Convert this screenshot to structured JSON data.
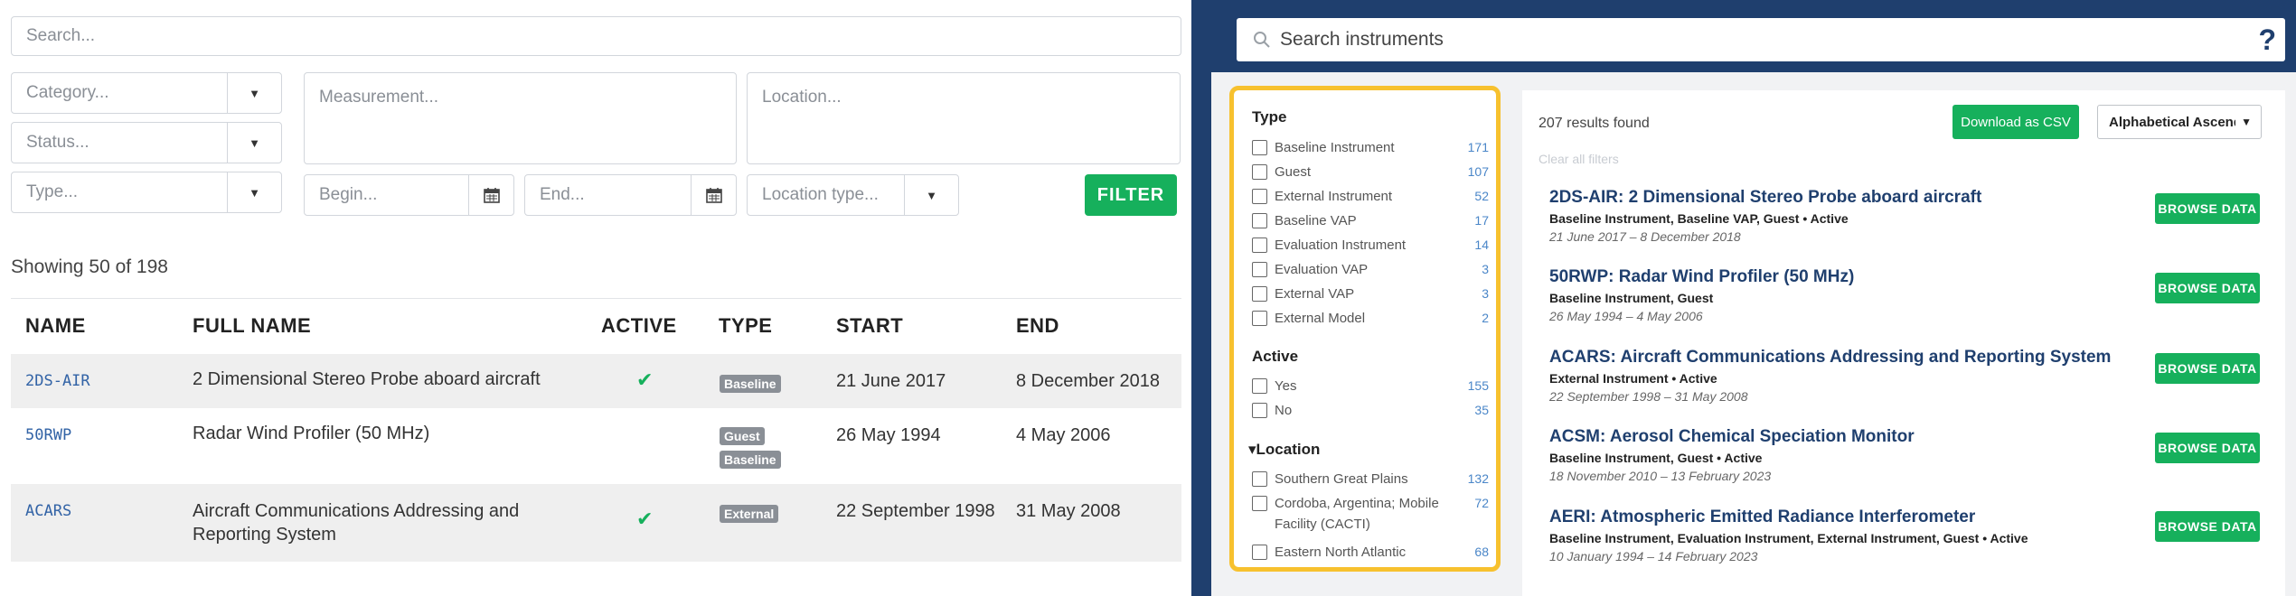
{
  "left": {
    "search_placeholder": "Search...",
    "category_placeholder": "Category...",
    "status_placeholder": "Status...",
    "type_placeholder": "Type...",
    "measurement_placeholder": "Measurement...",
    "location_placeholder": "Location...",
    "begin_placeholder": "Begin...",
    "end_placeholder": "End...",
    "location_type_placeholder": "Location type...",
    "filter_label": "FILTER",
    "showing": "Showing 50 of 198",
    "columns": [
      "NAME",
      "FULL NAME",
      "ACTIVE",
      "TYPE",
      "START",
      "END"
    ],
    "rows": [
      {
        "name": "2DS-AIR",
        "full_name_1": "2 Dimensional Stereo Probe aboard aircraft",
        "full_name_2": "",
        "active": "✔",
        "badge_1": "Baseline",
        "badge_2": "",
        "start": "21 June 2017",
        "end": "8 December 2018"
      },
      {
        "name": "50RWP",
        "full_name_1": "Radar Wind Profiler (50 MHz)",
        "full_name_2": "",
        "active": "",
        "badge_1": "Guest",
        "badge_2": "Baseline",
        "start": "26 May 1994",
        "end": "4 May 2006"
      },
      {
        "name": "ACARS",
        "full_name_1": "Aircraft Communications Addressing and",
        "full_name_2": "Reporting System",
        "active": "✔",
        "badge_1": "External",
        "badge_2": "",
        "start": "22 September 1998",
        "end": "31 May 2008"
      }
    ]
  },
  "right": {
    "search_placeholder": "Search instruments",
    "help": "?",
    "facets": {
      "type_heading": "Type",
      "type_items": [
        {
          "label": "Baseline Instrument",
          "count": "171"
        },
        {
          "label": "Guest",
          "count": "107"
        },
        {
          "label": "External Instrument",
          "count": "52"
        },
        {
          "label": "Baseline VAP",
          "count": "17"
        },
        {
          "label": "Evaluation Instrument",
          "count": "14"
        },
        {
          "label": "Evaluation VAP",
          "count": "3"
        },
        {
          "label": "External VAP",
          "count": "3"
        },
        {
          "label": "External Model",
          "count": "2"
        }
      ],
      "active_heading": "Active",
      "active_items": [
        {
          "label": "Yes",
          "count": "155"
        },
        {
          "label": "No",
          "count": "35"
        }
      ],
      "location_heading": "▾Location",
      "location_items": [
        {
          "label": "Southern Great Plains",
          "count": "132"
        },
        {
          "label": "Cordoba, Argentina; Mobile Facility (CACTI)",
          "count": "72"
        },
        {
          "label": "Eastern North Atlantic",
          "count": "68"
        }
      ]
    },
    "results_count": "207 results found",
    "clear_filters": "Clear all filters",
    "download_label": "Download as CSV",
    "sort_label": "Alphabetical Ascending",
    "browse_label": "BROWSE DATA",
    "results": [
      {
        "title": "2DS-AIR: 2 Dimensional Stereo Probe aboard aircraft",
        "meta": "Baseline Instrument, Baseline VAP, Guest •  Active",
        "dates": "21 June 2017 – 8 December 2018"
      },
      {
        "title": "50RWP: Radar Wind Profiler (50 MHz)",
        "meta": "Baseline Instrument, Guest",
        "dates": "26 May 1994 – 4 May 2006"
      },
      {
        "title": "ACARS: Aircraft Communications Addressing and Reporting System",
        "meta": "External Instrument •  Active",
        "dates": "22 September 1998 – 31 May 2008"
      },
      {
        "title": "ACSM: Aerosol Chemical Speciation Monitor",
        "meta": "Baseline Instrument, Guest •  Active",
        "dates": "18 November 2010 – 13 February 2023"
      },
      {
        "title": "AERI: Atmospheric Emitted Radiance Interferometer",
        "meta": "Baseline Instrument, Evaluation Instrument, External Instrument, Guest •  Active",
        "dates": "10 January 1994 – 14 February 2023"
      }
    ]
  },
  "colors": {
    "accent_green": "#16b05c",
    "navy": "#1f3f6e",
    "facet_border": "#f7c12e",
    "link_blue": "#3263a6"
  },
  "icons": [
    "calendar-icon",
    "chevron-down-icon",
    "search-icon",
    "help-icon",
    "check-icon"
  ]
}
